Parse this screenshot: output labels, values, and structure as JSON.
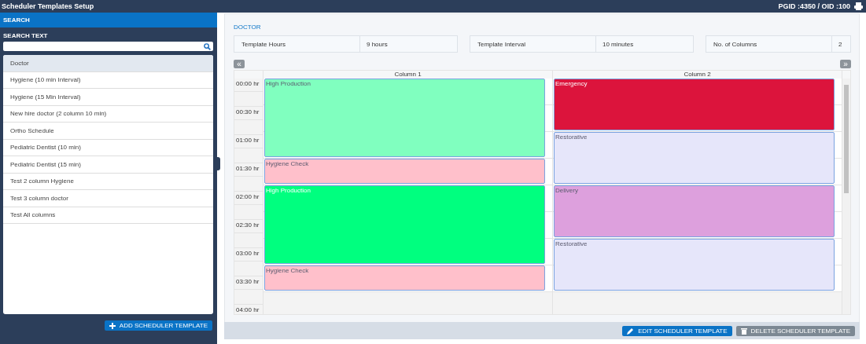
{
  "window": {
    "title": "Scheduler Templates Setup",
    "ids": "PGID :4350  /  OID :100"
  },
  "sidebar": {
    "header": "SEARCH",
    "search_label": "SEARCH TEXT",
    "items": [
      {
        "label": "Doctor",
        "selected": true
      },
      {
        "label": "Hygiene (10 min Interval)",
        "selected": false
      },
      {
        "label": "Hygiene (15 Min Interval)",
        "selected": false
      },
      {
        "label": "New hire doctor (2 column 10 min)",
        "selected": false
      },
      {
        "label": "Ortho Schedule",
        "selected": false
      },
      {
        "label": "Pediatric Dentist (10 min)",
        "selected": false
      },
      {
        "label": "Pediatric Dentist (15 min)",
        "selected": false
      },
      {
        "label": "Test 2 column Hygiene",
        "selected": false
      },
      {
        "label": "Test 3 column doctor",
        "selected": false
      },
      {
        "label": "Test All columns",
        "selected": false
      }
    ],
    "add_button": "ADD SCHEDULER TEMPLATE"
  },
  "template": {
    "name": "DOCTOR",
    "info": [
      {
        "label": "Template Hours",
        "value": "9 hours"
      },
      {
        "label": "Template Interval",
        "value": "10 minutes"
      },
      {
        "label": "No. of Columns",
        "value": "2"
      }
    ],
    "prev": "«",
    "next": "»",
    "times": [
      "00:00 hr",
      "00:30 hr",
      "01:00 hr",
      "01:30 hr",
      "02:00 hr",
      "02:30 hr",
      "03:00 hr",
      "03:30 hr",
      "04:00 hr"
    ],
    "columns": [
      {
        "title": "Column 1",
        "blocks": [
          {
            "label": "High Production",
            "kind": "tall",
            "color": "#80ffbf"
          },
          {
            "label": "Hygiene Check",
            "kind": "short",
            "color": "#ffc0cb"
          },
          {
            "label": "High Production",
            "kind": "tall",
            "color": "#00ff7f"
          },
          {
            "label": "Hygiene Check",
            "kind": "short",
            "color": "#ffc0cb"
          }
        ]
      },
      {
        "title": "Column 2",
        "blocks": [
          {
            "label": "Emergency",
            "kind": "medium",
            "color": "#dc143c"
          },
          {
            "label": "Restorative",
            "kind": "medium",
            "color": "#e6e6fa"
          },
          {
            "label": "Delivery",
            "kind": "medium",
            "color": "#dda0dd"
          },
          {
            "label": "Restorative",
            "kind": "medium",
            "color": "#e6e6fa"
          }
        ]
      }
    ],
    "edit_button": "EDIT SCHEDULER TEMPLATE",
    "delete_button": "DELETE SCHEDULER TEMPLATE"
  }
}
